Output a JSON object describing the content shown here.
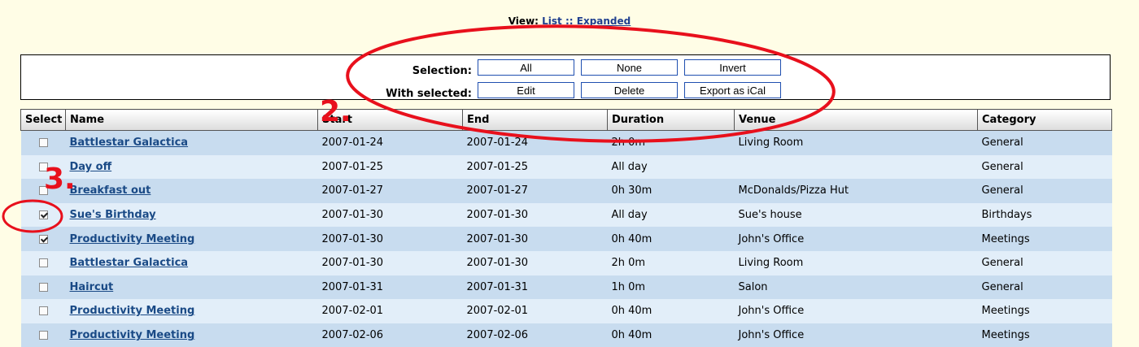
{
  "view": {
    "label": "View:",
    "list": "List",
    "separator": "::",
    "expanded": "Expanded"
  },
  "selection": {
    "label": "Selection:",
    "all": "All",
    "none": "None",
    "invert": "Invert",
    "with_label": "With selected:",
    "edit": "Edit",
    "delete": "Delete",
    "export": "Export as iCal"
  },
  "table": {
    "columns": [
      "Select",
      "Name",
      "Start",
      "End",
      "Duration",
      "Venue",
      "Category"
    ],
    "rows": [
      {
        "checked": false,
        "name": "Battlestar Galactica",
        "start": "2007-01-24",
        "end": "2007-01-24",
        "duration": "2h 0m",
        "venue": "Living Room",
        "category": "General"
      },
      {
        "checked": false,
        "name": "Day off",
        "start": "2007-01-25",
        "end": "2007-01-25",
        "duration": "All day",
        "venue": "",
        "category": "General"
      },
      {
        "checked": false,
        "name": "Breakfast out",
        "start": "2007-01-27",
        "end": "2007-01-27",
        "duration": "0h 30m",
        "venue": "McDonalds/Pizza Hut",
        "category": "General"
      },
      {
        "checked": true,
        "name": "Sue's Birthday",
        "start": "2007-01-30",
        "end": "2007-01-30",
        "duration": "All day",
        "venue": "Sue's house",
        "category": "Birthdays"
      },
      {
        "checked": true,
        "name": "Productivity Meeting",
        "start": "2007-01-30",
        "end": "2007-01-30",
        "duration": "0h 40m",
        "venue": "John's Office",
        "category": "Meetings"
      },
      {
        "checked": false,
        "name": "Battlestar Galactica",
        "start": "2007-01-30",
        "end": "2007-01-30",
        "duration": "2h 0m",
        "venue": "Living Room",
        "category": "General"
      },
      {
        "checked": false,
        "name": "Haircut",
        "start": "2007-01-31",
        "end": "2007-01-31",
        "duration": "1h 0m",
        "venue": "Salon",
        "category": "General"
      },
      {
        "checked": false,
        "name": "Productivity Meeting",
        "start": "2007-02-01",
        "end": "2007-02-01",
        "duration": "0h 40m",
        "venue": "John's Office",
        "category": "Meetings"
      },
      {
        "checked": false,
        "name": "Productivity Meeting",
        "start": "2007-02-06",
        "end": "2007-02-06",
        "duration": "0h 40m",
        "venue": "John's Office",
        "category": "Meetings"
      }
    ]
  },
  "annotations": {
    "step2": "2.",
    "step3": "3.",
    "color": "#e8101c"
  }
}
